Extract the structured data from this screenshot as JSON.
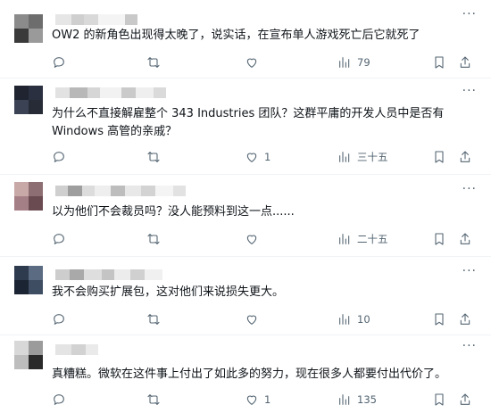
{
  "more_label": "···",
  "posts": [
    {
      "text": "OW2 的新角色出现得太晚了，说实话，在宣布单人游戏死亡后它就死了",
      "views": "79",
      "likes": ""
    },
    {
      "text": "为什么不直接解雇整个 343 Industries 团队？这群平庸的开发人员中是否有 Windows 高管的亲戚？",
      "views": "三十五",
      "likes": "1"
    },
    {
      "text": "以为他们不会裁员吗？没人能预料到这一点......",
      "views": "二十五",
      "likes": ""
    },
    {
      "text": "我不会购买扩展包，这对他们来说损失更大。",
      "views": "10",
      "likes": ""
    },
    {
      "text": "真糟糕。微软在这件事上付出了如此多的努力，现在很多人都要付出代价了。",
      "views": "135",
      "likes": "1"
    }
  ],
  "icons": {
    "reply": "reply-icon",
    "retweet": "retweet-icon",
    "like": "heart-icon",
    "views": "views-chart-icon",
    "bookmark": "bookmark-icon",
    "share": "share-icon",
    "more": "more-dots-icon"
  },
  "colors": {
    "text": "#0f1419",
    "secondary": "#536471",
    "divider": "#eff3f4"
  }
}
